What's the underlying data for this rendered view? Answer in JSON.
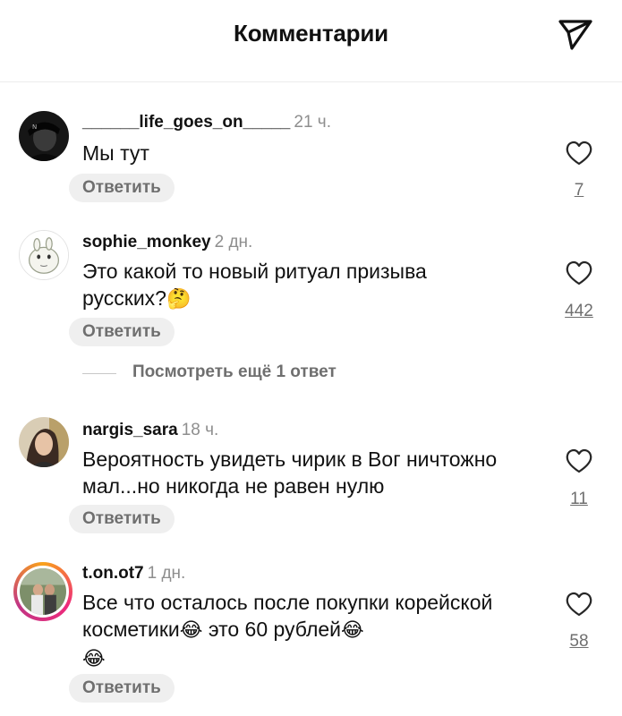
{
  "header": {
    "title": "Комментарии",
    "share_icon": "send-paper-plane-icon"
  },
  "comments": [
    {
      "username": "______life_goes_on_____",
      "time": "21 ч.",
      "text": "Мы тут",
      "text_emoji": "",
      "text2": "",
      "reply_label": "Ответить",
      "likes": "7"
    },
    {
      "username": "sophie_monkey",
      "time": "2 дн.",
      "text": "Это какой то новый ритуал призыва русских?",
      "text_emoji": "🤔",
      "text2": "",
      "reply_label": "Ответить",
      "likes": "442"
    },
    {
      "username": "nargis_sara",
      "time": "18 ч.",
      "text": "Вероятность увидеть чирик в Вог ничтожно мал...но никогда не равен нулю",
      "text_emoji": "",
      "text2": "",
      "reply_label": "Ответить",
      "likes": "11"
    },
    {
      "username": "t.on.ot7",
      "time": "1 дн.",
      "text": "Все что осталось после покупки корейской косметики",
      "text_emoji": "😂",
      "text2": " это 60 рублей",
      "reply_label": "Ответить",
      "likes": "58"
    }
  ],
  "more_replies": "Посмотреть ещё 1 ответ",
  "colors": {
    "background": "#ffffff",
    "muted": "#8e8e8e",
    "reply_bg": "#efefef",
    "story_ring": "#ee2a7b"
  }
}
